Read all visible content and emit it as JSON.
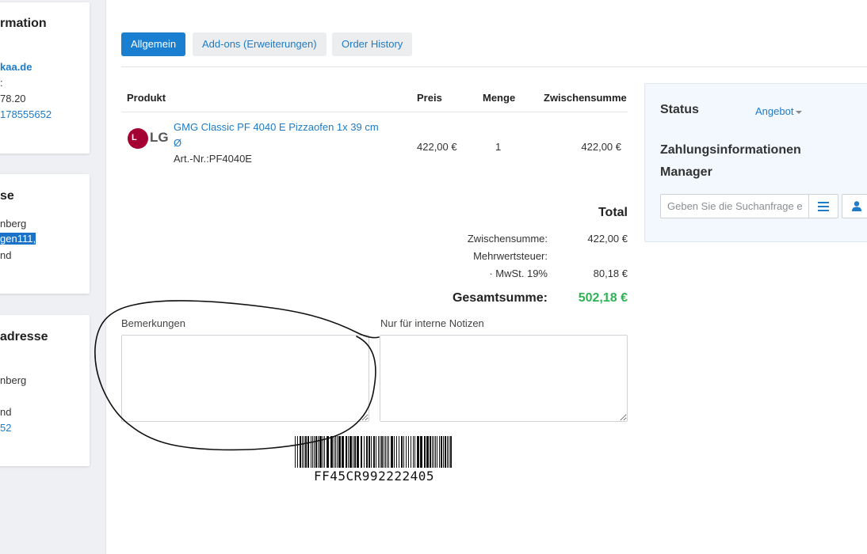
{
  "sidebar": {
    "card1": {
      "title": "rmation",
      "lines": [
        "kaa.de",
        ":",
        "78.20",
        "178555652"
      ]
    },
    "card2": {
      "title": "se",
      "lines": [
        "nberg",
        "gen111,",
        "nd"
      ]
    },
    "card3": {
      "title": "adresse",
      "lines": [
        "nberg",
        "nd",
        "52"
      ]
    }
  },
  "tabs": {
    "general": "Allgemein",
    "addons": "Add-ons (Erweiterungen)",
    "history": "Order History"
  },
  "table": {
    "headers": {
      "product": "Produkt",
      "price": "Preis",
      "qty": "Menge",
      "subtotal": "Zwischensumme"
    },
    "rows": [
      {
        "brand": "LG",
        "brand_letters": "L",
        "name_line1": "GMG Classic PF 4040 E Pizzaofen 1x 39 cm",
        "name_line2": "Ø",
        "sku": "Art.-Nr.:PF4040E",
        "price": "422,00 €",
        "qty": "1",
        "subtotal": "422,00 €"
      }
    ]
  },
  "totals": {
    "title": "Total",
    "subtotal_label": "Zwischensumme:",
    "subtotal_value": "422,00 €",
    "vat_label": "Mehrwertsteuer:",
    "vat_rate_label": "· MwSt. 19%",
    "vat_rate_value": "80,18 €",
    "grand_label": "Gesamtsumme:",
    "grand_value": "502,18 €"
  },
  "notes": {
    "remarks_label": "Bemerkungen",
    "internal_label": "Nur für interne Notizen"
  },
  "barcode": {
    "text": "FF45CR992222405"
  },
  "panel": {
    "status_label": "Status",
    "status_value": "Angebot",
    "payment_label": "Zahlungsinformationen",
    "manager_label": "Manager",
    "search_placeholder": "Geben Sie die Suchanfrage ein"
  },
  "colors": {
    "accent": "#1a7fd1",
    "link": "#1f7bc6",
    "grand_total": "#2db354",
    "lg_brand": "#a50034"
  },
  "icons": {
    "list": "list-icon",
    "user": "user-icon",
    "caret": "caret-down-icon"
  }
}
